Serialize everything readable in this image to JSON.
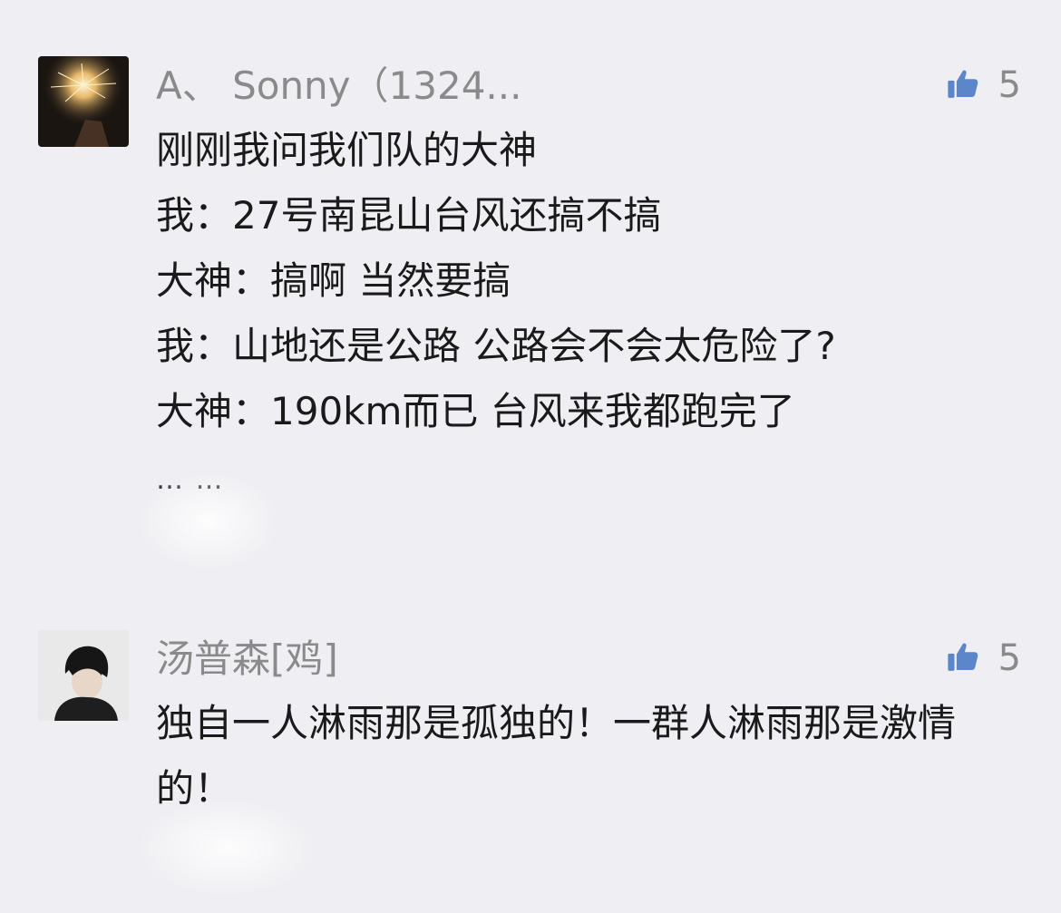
{
  "comments": [
    {
      "nickname": "A、 Sonny（1324...",
      "likes": "5",
      "avatar_icon": "sparkler-avatar-icon",
      "lines": [
        "刚刚我问我们队的大神",
        "我：27号南昆山台风还搞不搞",
        "大神：搞啊  当然要搞",
        "我：山地还是公路 公路会不会太危险了?",
        "大神：190km而已  台风来我都跑完了"
      ],
      "ellipsis": "… …"
    },
    {
      "nickname": "汤普森[鸡]",
      "likes": "5",
      "avatar_icon": "person-avatar-icon",
      "text": "独自一人淋雨那是孤独的！一群人淋雨那是激情的！"
    }
  ],
  "colors": {
    "background": "#efeff3",
    "like_icon": "#5b86c9",
    "nickname": "#8a8a8a",
    "text": "#1a1a1a"
  },
  "icons": {
    "like": "thumbs-up-icon"
  }
}
